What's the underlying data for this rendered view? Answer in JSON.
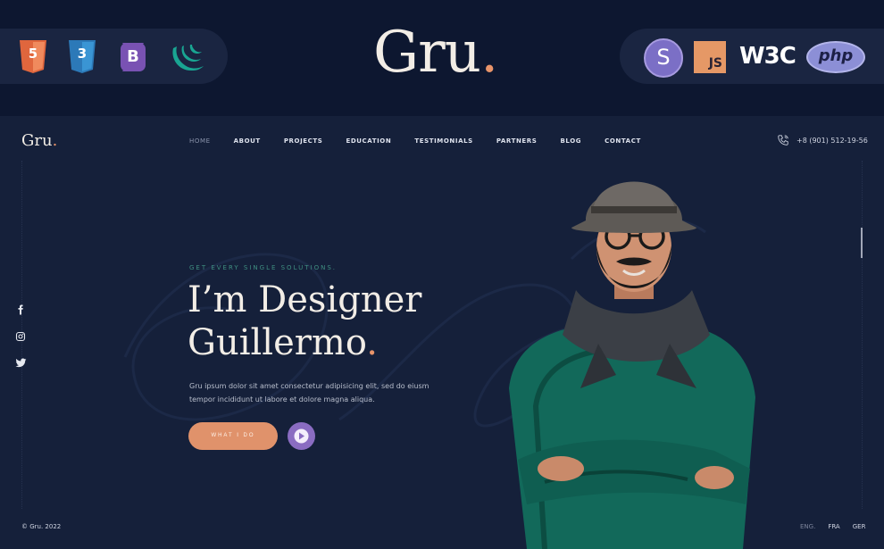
{
  "banner": {
    "brand": "Gru",
    "brand_dot": ".",
    "left_badges": [
      {
        "name": "html5-icon",
        "label": "5",
        "color": "#e0663d"
      },
      {
        "name": "css3-icon",
        "label": "3",
        "color": "#2c79b8"
      },
      {
        "name": "bootstrap-icon",
        "label": "B",
        "color": "#7952b3"
      },
      {
        "name": "jquery-icon",
        "color": "#19a592"
      }
    ],
    "right_badges": {
      "sass": "S",
      "js": "JS",
      "w3c": "W3C",
      "php": "php"
    }
  },
  "site": {
    "logo": "Gru",
    "logo_dot": ".",
    "nav": [
      "HOME",
      "ABOUT",
      "PROJECTS",
      "EDUCATION",
      "TESTIMONIALS",
      "PARTNERS",
      "BLOG",
      "CONTACT"
    ],
    "active_nav": "HOME",
    "phone": "+8 (901) 512-19-56",
    "hero": {
      "eyebrow": "GET EVERY SINGLE SOLUTIONS.",
      "line1": "I’m Designer",
      "line2": "Guillermo",
      "line2_dot": ".",
      "description": "Gru ipsum dolor sit amet consectetur adipisicing elit, sed do eiusm tempor incididunt ut labore et dolore magna aliqua.",
      "cta": "WHAT I DO"
    },
    "social": [
      "facebook-icon",
      "instagram-icon",
      "twitter-icon"
    ],
    "copyright": "© Gru. 2022",
    "languages": [
      "ENG.",
      "FRA",
      "GER"
    ],
    "colors": {
      "background": "#15203a",
      "accent": "#e8946a",
      "teal": "#3f8e80",
      "play": "#8a6cc2"
    }
  }
}
